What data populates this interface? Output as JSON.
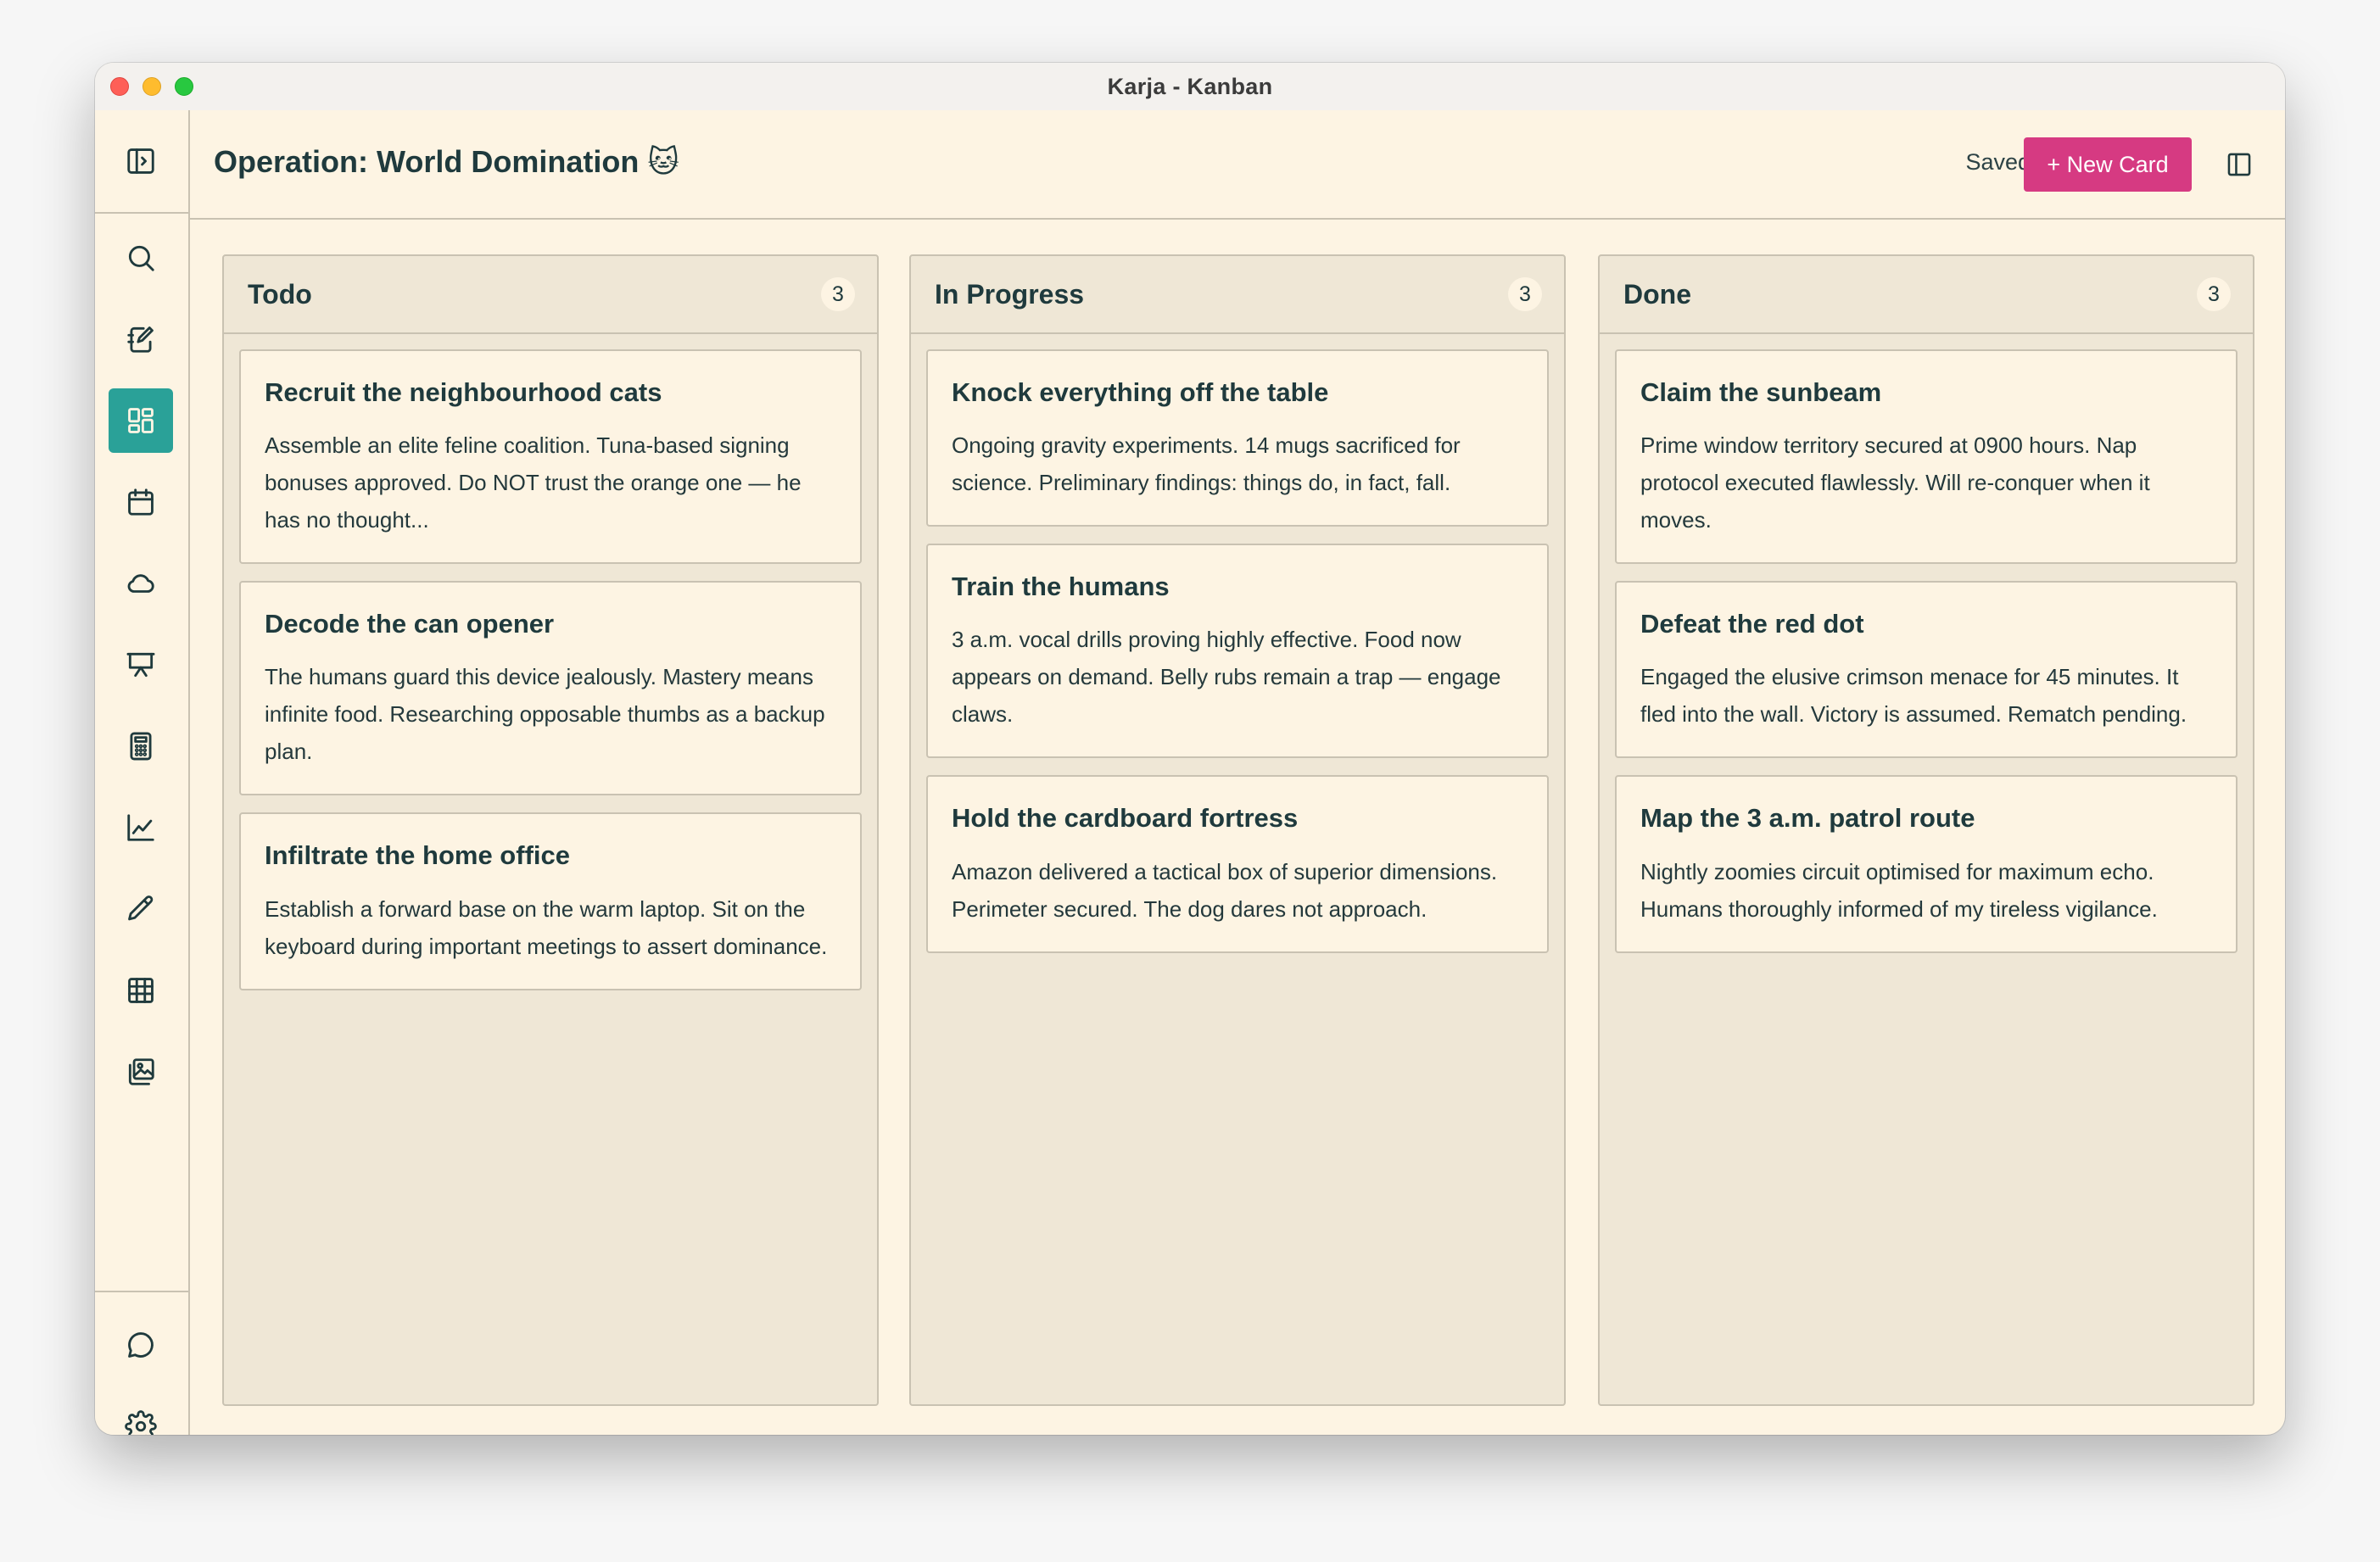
{
  "window": {
    "title": "Karja - Kanban"
  },
  "header": {
    "title": "Operation: World Domination 🐱",
    "status": "Saved",
    "new_card_label": "+ New Card"
  },
  "sidebar": {
    "top": [
      {
        "icon": "sidebar-toggle-icon"
      }
    ],
    "items": [
      {
        "icon": "search-icon"
      },
      {
        "icon": "notebook-edit-icon"
      },
      {
        "icon": "kanban-grid-icon",
        "active": true
      },
      {
        "icon": "calendar-icon"
      },
      {
        "icon": "cloud-icon"
      },
      {
        "icon": "presentation-icon"
      },
      {
        "icon": "calculator-icon"
      },
      {
        "icon": "chart-line-icon"
      },
      {
        "icon": "pencil-icon"
      },
      {
        "icon": "table-icon"
      },
      {
        "icon": "gallery-icon"
      }
    ],
    "bottom": [
      {
        "icon": "chat-icon"
      },
      {
        "icon": "settings-gear-icon"
      }
    ]
  },
  "colors": {
    "accent": "#d63a82",
    "active": "#2aa198",
    "background": "#fdf4e3",
    "column": "#efe7d6"
  },
  "columns": [
    {
      "title": "Todo",
      "count": "3",
      "cards": [
        {
          "title": "Recruit the neighbourhood cats",
          "body": "Assemble an elite feline coalition. Tuna-based signing bonuses approved. Do NOT trust the orange one — he has no thought..."
        },
        {
          "title": "Decode the can opener",
          "body": "The humans guard this device jealously. Mastery means infinite food. Researching opposable thumbs as a backup plan."
        },
        {
          "title": "Infiltrate the home office",
          "body": "Establish a forward base on the warm laptop. Sit on the keyboard during important meetings to assert dominance."
        }
      ]
    },
    {
      "title": "In Progress",
      "count": "3",
      "cards": [
        {
          "title": "Knock everything off the table",
          "body": "Ongoing gravity experiments. 14 mugs sacrificed for science. Preliminary findings: things do, in fact, fall."
        },
        {
          "title": "Train the humans",
          "body": "3 a.m. vocal drills proving highly effective. Food now appears on demand. Belly rubs remain a trap — engage claws."
        },
        {
          "title": "Hold the cardboard fortress",
          "body": "Amazon delivered a tactical box of superior dimensions. Perimeter secured. The dog dares not approach."
        }
      ]
    },
    {
      "title": "Done",
      "count": "3",
      "cards": [
        {
          "title": "Claim the sunbeam",
          "body": "Prime window territory secured at 0900 hours. Nap protocol executed flawlessly. Will re-conquer when it moves."
        },
        {
          "title": "Defeat the red dot",
          "body": "Engaged the elusive crimson menace for 45 minutes. It fled into the wall. Victory is assumed. Rematch pending."
        },
        {
          "title": "Map the 3 a.m. patrol route",
          "body": "Nightly zoomies circuit optimised for maximum echo. Humans thoroughly informed of my tireless vigilance."
        }
      ]
    }
  ]
}
